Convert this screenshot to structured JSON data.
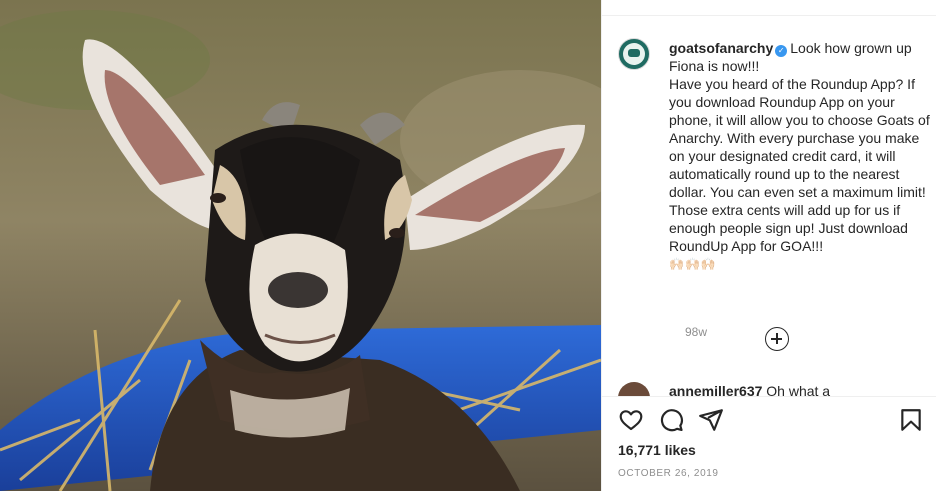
{
  "post": {
    "image_alt": "Goat lying in hay",
    "user": {
      "username": "goatsofanarchy",
      "verified": true
    },
    "caption": {
      "line1": "Look how grown up Fiona is now!!!",
      "line2": "Have you heard of the Roundup App? If you download Roundup App on your phone, it will allow you to choose Goats of Anarchy. With every purchase you make on your designated credit card, it will automatically round up to the nearest dollar. You can even set a maximum limit! Those extra cents will add up for us if enough people sign up! Just download RoundUp App for GOA!!!",
      "emoji": "🙌🏻🙌🏻🙌🏻",
      "time": "98w"
    },
    "comment": {
      "username": "annemiller637",
      "text": "Oh what a"
    },
    "likes": "16,771 likes",
    "date": "OCTOBER 26, 2019"
  },
  "icons": {
    "like": "heart-icon",
    "comment": "comment-icon",
    "share": "share-icon",
    "save": "bookmark-icon",
    "load_more": "plus-circle-icon"
  },
  "colors": {
    "text": "#262626",
    "muted": "#8e8e8e",
    "verified": "#3897f0",
    "border": "#efefef"
  }
}
